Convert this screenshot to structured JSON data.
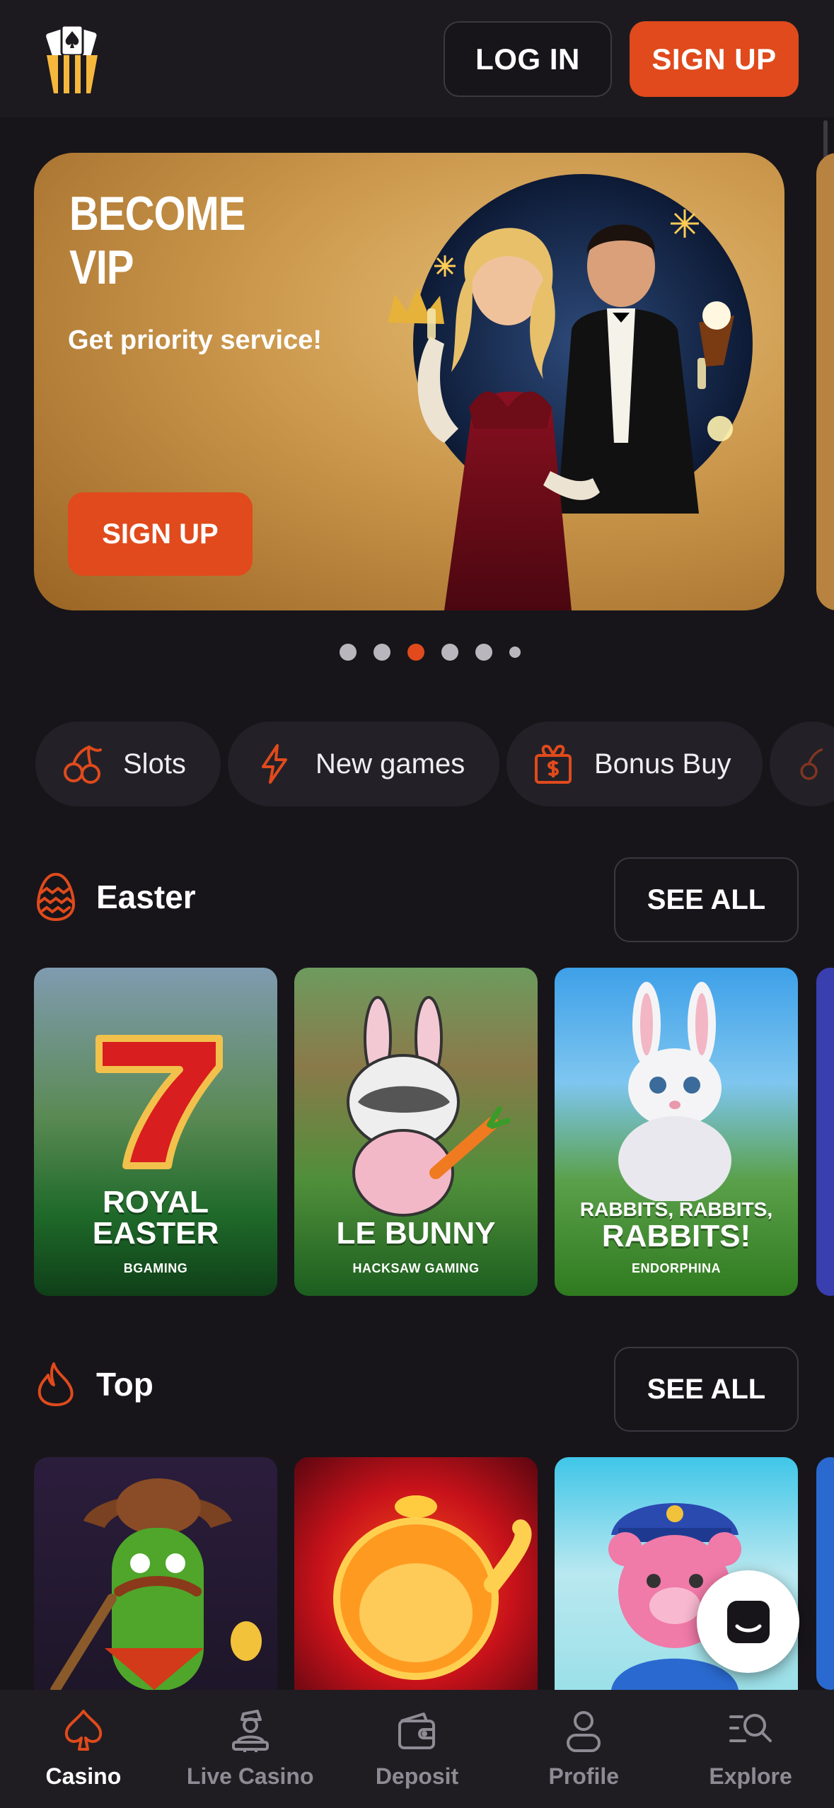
{
  "header": {
    "logo_icon": "popcorn-cards-logo",
    "login_label": "LOG IN",
    "signup_label": "SIGN UP"
  },
  "banner": {
    "title_line1": "BECOME",
    "title_line2": "VIP",
    "subtitle": "Get priority service!",
    "cta_label": "SIGN UP",
    "slide_index": 3,
    "slide_count": 6
  },
  "categories": [
    {
      "label": "Slots",
      "icon": "cherry-icon"
    },
    {
      "label": "New games",
      "icon": "lightning-icon"
    },
    {
      "label": "Bonus Buy",
      "icon": "gift-dollar-icon"
    }
  ],
  "sections": {
    "easter": {
      "title": "Easter",
      "icon": "easter-egg-icon",
      "see_all": "SEE ALL",
      "games": [
        {
          "line1": "ROYAL",
          "line2": "EASTER",
          "provider": "BGAMING"
        },
        {
          "line1": "",
          "line2": "LE BUNNY",
          "provider": "HACKSAW GAMING"
        },
        {
          "line1": "RABBITS, RABBITS,",
          "line2": "RABBITS!",
          "provider": "ENDORPHINA"
        }
      ]
    },
    "top": {
      "title": "Top",
      "icon": "flame-icon",
      "see_all": "SEE ALL"
    }
  },
  "nav": [
    {
      "label": "Casino",
      "icon": "spade-icon",
      "active": true
    },
    {
      "label": "Live Casino",
      "icon": "dealer-icon",
      "active": false
    },
    {
      "label": "Deposit",
      "icon": "wallet-icon",
      "active": false
    },
    {
      "label": "Profile",
      "icon": "user-icon",
      "active": false
    },
    {
      "label": "Explore",
      "icon": "search-list-icon",
      "active": false
    }
  ],
  "colors": {
    "accent": "#e04a1c",
    "background": "#17151a",
    "surface": "#232127"
  }
}
